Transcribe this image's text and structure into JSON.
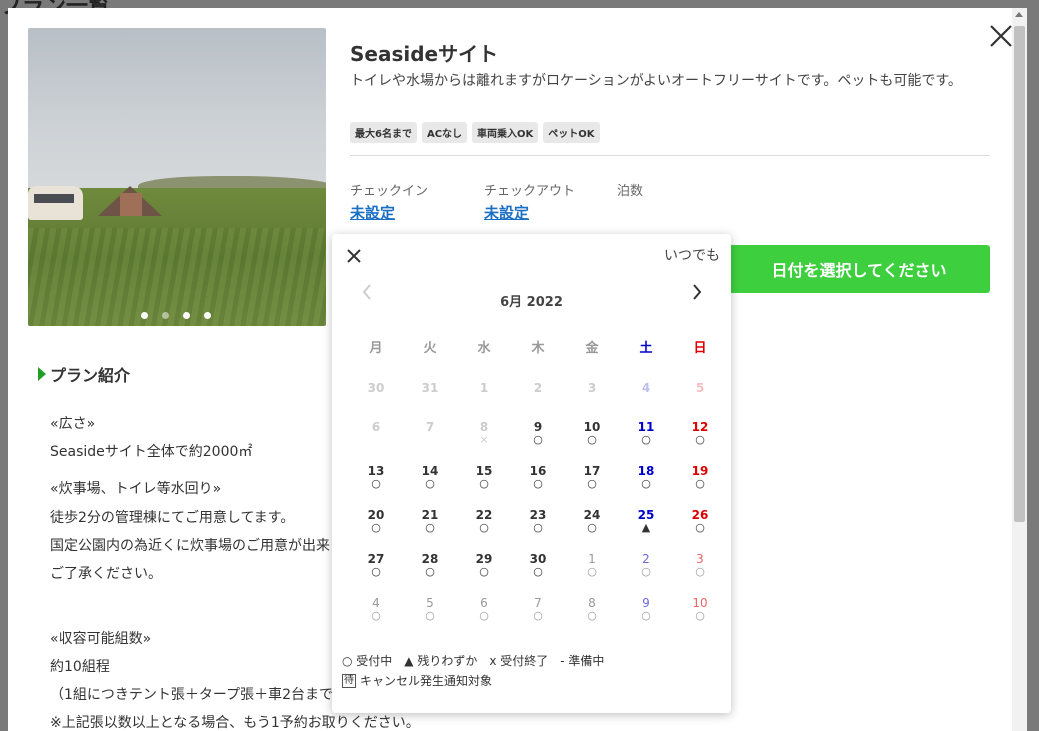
{
  "background": {
    "title": "プラン一覧"
  },
  "site": {
    "title": "Seasideサイト",
    "description": "トイレや水場からは離れますがロケーションがよいオートフリーサイトです。ペットも可能です。",
    "tags": [
      "最大6名まで",
      "ACなし",
      "車両乗入OK",
      "ペットOK"
    ]
  },
  "checkin": {
    "label": "チェックイン",
    "value": "未設定"
  },
  "checkout": {
    "label": "チェックアウト",
    "value": "未設定"
  },
  "nights": {
    "label": "泊数"
  },
  "select_date_button": "日付を選択してください",
  "plan": {
    "heading": "プラン紹介",
    "lines": [
      "«広さ»",
      "Seasideサイト全体で約2000㎡",
      "«炊事場、トイレ等水回り»",
      "徒歩2分の管理棟にてご用意してます。",
      "国定公園内の為近くに炊事場のご用意が出来",
      "ご了承ください。",
      "«収容可能組数»",
      "約10組程",
      "（1組につきテント張＋タープ張＋車2台まで",
      "※上記張以数以上となる場合、もう1予約お取りください。"
    ]
  },
  "calendar": {
    "anytime": "いつでも",
    "month": "6月 2022",
    "weekdays": [
      "月",
      "火",
      "水",
      "木",
      "金",
      "土",
      "日"
    ],
    "weekday_colors": [
      "#999999",
      "#999999",
      "#999999",
      "#999999",
      "#999999",
      "#0000cc",
      "#dd0000"
    ],
    "weeks": [
      [
        {
          "d": "30",
          "s": "",
          "st": "past"
        },
        {
          "d": "31",
          "s": "",
          "st": "past"
        },
        {
          "d": "1",
          "s": "",
          "st": "past"
        },
        {
          "d": "2",
          "s": "",
          "st": "past"
        },
        {
          "d": "3",
          "s": "",
          "st": "past"
        },
        {
          "d": "4",
          "s": "",
          "st": "past"
        },
        {
          "d": "5",
          "s": "",
          "st": "past"
        }
      ],
      [
        {
          "d": "6",
          "s": "",
          "st": "past"
        },
        {
          "d": "7",
          "s": "",
          "st": "past"
        },
        {
          "d": "8",
          "s": "×",
          "st": "past"
        },
        {
          "d": "9",
          "s": "○",
          "st": "open"
        },
        {
          "d": "10",
          "s": "○",
          "st": "open"
        },
        {
          "d": "11",
          "s": "○",
          "st": "open"
        },
        {
          "d": "12",
          "s": "○",
          "st": "open"
        }
      ],
      [
        {
          "d": "13",
          "s": "○",
          "st": "open"
        },
        {
          "d": "14",
          "s": "○",
          "st": "open"
        },
        {
          "d": "15",
          "s": "○",
          "st": "open"
        },
        {
          "d": "16",
          "s": "○",
          "st": "open"
        },
        {
          "d": "17",
          "s": "○",
          "st": "open"
        },
        {
          "d": "18",
          "s": "○",
          "st": "open"
        },
        {
          "d": "19",
          "s": "○",
          "st": "open"
        }
      ],
      [
        {
          "d": "20",
          "s": "○",
          "st": "open"
        },
        {
          "d": "21",
          "s": "○",
          "st": "open"
        },
        {
          "d": "22",
          "s": "○",
          "st": "open"
        },
        {
          "d": "23",
          "s": "○",
          "st": "open"
        },
        {
          "d": "24",
          "s": "○",
          "st": "open"
        },
        {
          "d": "25",
          "s": "▲",
          "st": "open"
        },
        {
          "d": "26",
          "s": "○",
          "st": "open"
        }
      ],
      [
        {
          "d": "27",
          "s": "○",
          "st": "open"
        },
        {
          "d": "28",
          "s": "○",
          "st": "open"
        },
        {
          "d": "29",
          "s": "○",
          "st": "open"
        },
        {
          "d": "30",
          "s": "○",
          "st": "open"
        },
        {
          "d": "1",
          "s": "○",
          "st": "next"
        },
        {
          "d": "2",
          "s": "○",
          "st": "next"
        },
        {
          "d": "3",
          "s": "○",
          "st": "next"
        }
      ],
      [
        {
          "d": "4",
          "s": "○",
          "st": "next"
        },
        {
          "d": "5",
          "s": "○",
          "st": "next"
        },
        {
          "d": "6",
          "s": "○",
          "st": "next"
        },
        {
          "d": "7",
          "s": "○",
          "st": "next"
        },
        {
          "d": "8",
          "s": "○",
          "st": "next"
        },
        {
          "d": "9",
          "s": "○",
          "st": "next"
        },
        {
          "d": "10",
          "s": "○",
          "st": "next"
        }
      ]
    ],
    "legend": "○ 受付中　▲ 残りわずか　x 受付終了　- 準備中",
    "legend_badge": "待",
    "legend_note": "キャンセル発生通知対象"
  },
  "colors": {
    "accent_green": "#3ecf3f",
    "link_blue": "#1a6fc4",
    "saturday": "#0000cc",
    "sunday": "#dd0000"
  }
}
